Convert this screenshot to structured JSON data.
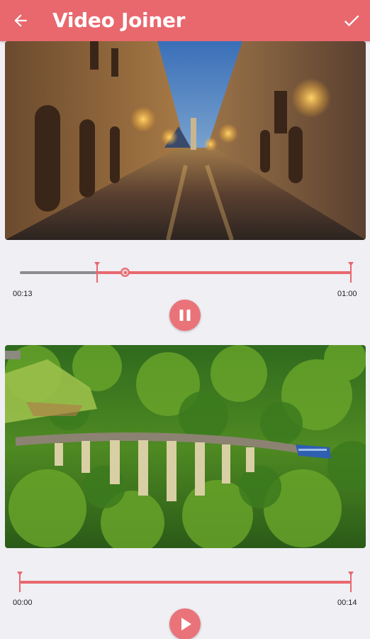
{
  "appbar": {
    "title": "Video Joiner",
    "back_icon": "arrow-left-icon",
    "confirm_icon": "check-icon",
    "color": "#e8686e"
  },
  "clips": [
    {
      "thumbnail": "night-city-street",
      "start_time": "00:13",
      "end_time": "01:00",
      "playhead_progress": 0.25,
      "state_icon": "pause-icon"
    },
    {
      "thumbnail": "railway-viaduct-forest",
      "start_time": "00:00",
      "end_time": "00:14",
      "state_icon": "play-icon"
    }
  ],
  "colors": {
    "accent": "#e8686e",
    "track_unselected": "#8c8c90",
    "background": "#efeff4"
  }
}
